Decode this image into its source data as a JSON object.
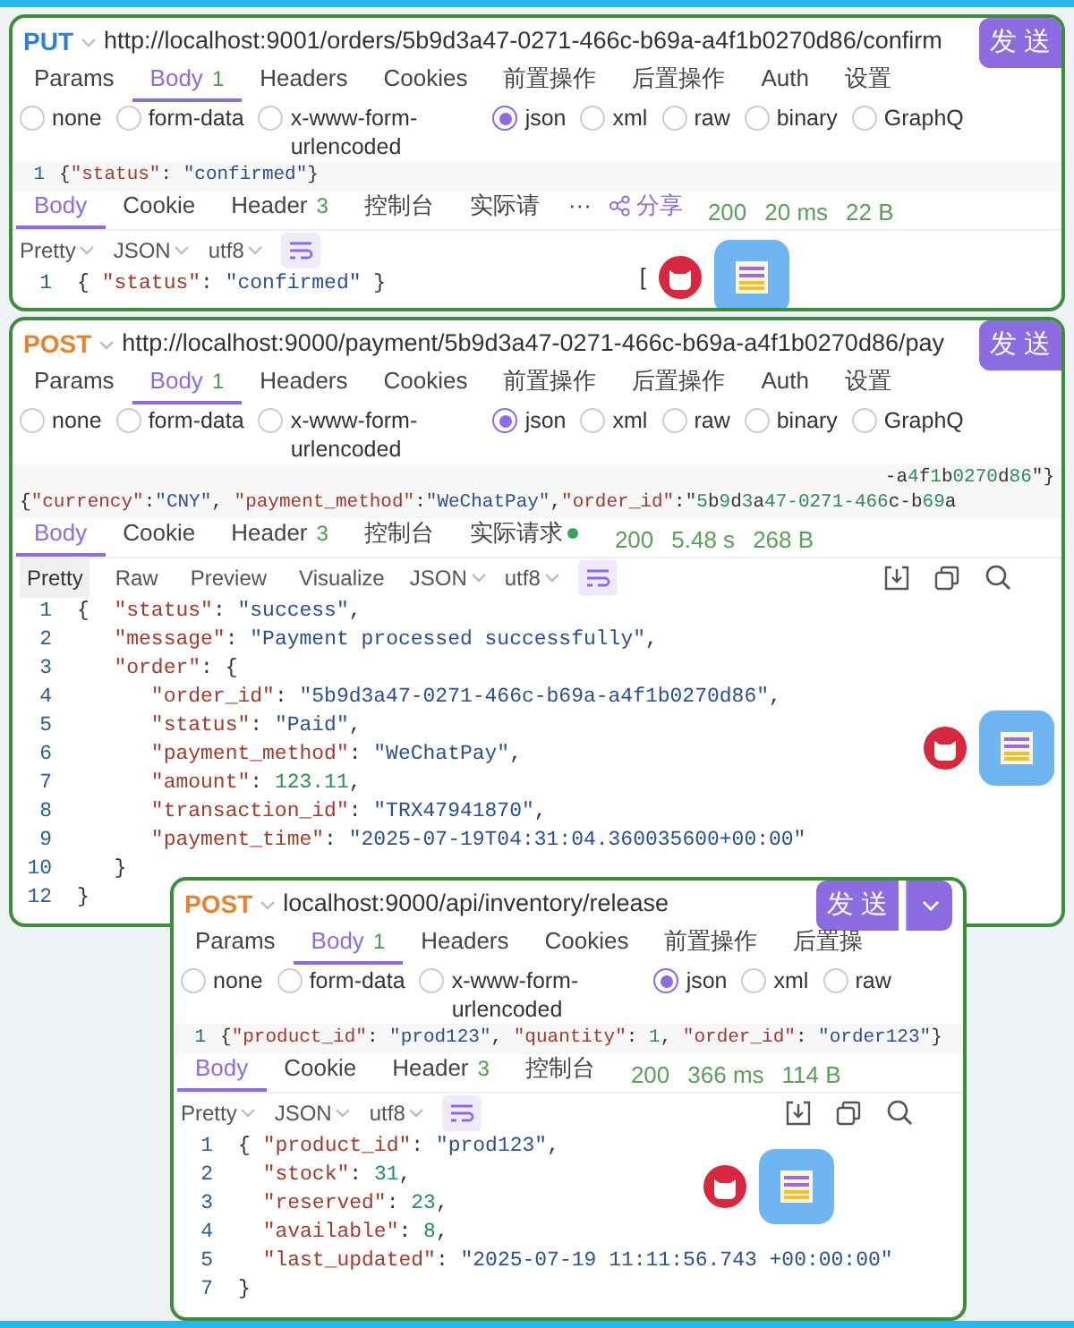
{
  "panels": [
    {
      "method": {
        "label": "PUT",
        "kind": "put"
      },
      "url": "http://localhost:9001/orders/5b9d3a47-0271-466c-b69a-a4f1b0270d86/confirm",
      "send": {
        "label": "发 送",
        "dropdown": false
      },
      "request_tabs": [
        {
          "label": "Params",
          "selected": false
        },
        {
          "label": "Body",
          "count": "1",
          "selected": true
        },
        {
          "label": "Headers",
          "selected": false
        },
        {
          "label": "Cookies",
          "selected": false
        },
        {
          "label": "前置操作",
          "selected": false
        },
        {
          "label": "后置操作",
          "selected": false
        },
        {
          "label": "Auth",
          "selected": false
        },
        {
          "label": "设置",
          "selected": false
        }
      ],
      "body_types": [
        {
          "label": "none",
          "selected": false
        },
        {
          "label": "form-data",
          "selected": false
        },
        {
          "label": "x-www-form-urlencoded",
          "selected": false
        },
        {
          "label": "json",
          "selected": true
        },
        {
          "label": "xml",
          "selected": false
        },
        {
          "label": "raw",
          "selected": false
        },
        {
          "label": "binary",
          "selected": false
        },
        {
          "label": "GraphQ",
          "selected": false
        }
      ],
      "request_body": {
        "lines": [
          {
            "number": "1",
            "text": "{\"status\": \"confirmed\"}"
          }
        ]
      },
      "response_tabs": [
        {
          "label": "Body",
          "selected": true
        },
        {
          "label": "Cookie",
          "selected": false
        },
        {
          "label": "Header",
          "count": "3",
          "selected": false
        },
        {
          "label": "控制台",
          "selected": false
        },
        {
          "label": "实际请",
          "selected": false,
          "dot": false
        }
      ],
      "response_actions": [
        {
          "kind": "more",
          "label": "···"
        },
        {
          "kind": "share",
          "label": "分享"
        }
      ],
      "status": {
        "code": "200",
        "time": "20 ms",
        "size": "22 B"
      },
      "selectors": [
        "Pretty",
        "JSON",
        "utf8"
      ],
      "toolbar_icons": [
        {
          "kind": "wrap"
        }
      ],
      "overlay_text": "[",
      "response_body": {
        "lines": [
          {
            "number": "1",
            "text": "{ \"status\": \"confirmed\" }"
          }
        ]
      }
    },
    {
      "method": {
        "label": "POST",
        "kind": "post"
      },
      "url": "http://localhost:9000/payment/5b9d3a47-0271-466c-b69a-a4f1b0270d86/pay",
      "send": {
        "label": "发 送",
        "dropdown": false
      },
      "request_tabs": [
        {
          "label": "Params",
          "selected": false
        },
        {
          "label": "Body",
          "count": "1",
          "selected": true
        },
        {
          "label": "Headers",
          "selected": false
        },
        {
          "label": "Cookies",
          "selected": false
        },
        {
          "label": "前置操作",
          "selected": false
        },
        {
          "label": "后置操作",
          "selected": false
        },
        {
          "label": "Auth",
          "selected": false
        },
        {
          "label": "设置",
          "selected": false
        }
      ],
      "body_types": [
        {
          "label": "none",
          "selected": false
        },
        {
          "label": "form-data",
          "selected": false
        },
        {
          "label": "x-www-form-urlencoded",
          "selected": false
        },
        {
          "label": "json",
          "selected": true
        },
        {
          "label": "xml",
          "selected": false
        },
        {
          "label": "raw",
          "selected": false
        },
        {
          "label": "binary",
          "selected": false
        },
        {
          "label": "GraphQ",
          "selected": false
        }
      ],
      "request_body": {
        "continuation": "-a4f1b0270d86\"}",
        "lines": [
          {
            "text": "{\"currency\":\"CNY\", \"payment_method\":\"WeChatPay\",\"order_id\":\"5b9d3a47-0271-466c-b69a"
          }
        ]
      },
      "response_tabs": [
        {
          "label": "Body",
          "selected": true
        },
        {
          "label": "Cookie",
          "selected": false
        },
        {
          "label": "Header",
          "count": "3",
          "selected": false
        },
        {
          "label": "控制台",
          "selected": false
        },
        {
          "label": "实际请求",
          "selected": false,
          "dot": true
        }
      ],
      "status": {
        "code": "200",
        "time": "5.48 s",
        "size": "268 B"
      },
      "view_modes": [
        {
          "label": "Pretty",
          "selected": true
        },
        {
          "label": "Raw",
          "selected": false
        },
        {
          "label": "Preview",
          "selected": false
        },
        {
          "label": "Visualize",
          "selected": false
        }
      ],
      "selectors": [
        "JSON",
        "utf8"
      ],
      "toolbar_icons": [
        {
          "kind": "wrap"
        },
        {
          "kind": "download"
        },
        {
          "kind": "copy"
        },
        {
          "kind": "search"
        }
      ],
      "response_body": {
        "lines": [
          {
            "number": "1",
            "text": "{  \"status\": \"success\","
          },
          {
            "number": "2",
            "text": "   \"message\": \"Payment processed successfully\","
          },
          {
            "number": "3",
            "text": "   \"order\": {"
          },
          {
            "number": "4",
            "text": "      \"order_id\": \"5b9d3a47-0271-466c-b69a-a4f1b0270d86\","
          },
          {
            "number": "5",
            "text": "      \"status\": \"Paid\","
          },
          {
            "number": "6",
            "text": "      \"payment_method\": \"WeChatPay\","
          },
          {
            "number": "7",
            "text": "      \"amount\": 123.11,"
          },
          {
            "number": "8",
            "text": "      \"transaction_id\": \"TRX47941870\","
          },
          {
            "number": "9",
            "text": "      \"payment_time\": \"2025-07-19T04:31:04.360035600+00:00\""
          },
          {
            "number": "10",
            "text": "   }"
          },
          {
            "number": "12",
            "text": "}"
          }
        ]
      }
    },
    {
      "method": {
        "label": "POST",
        "kind": "post"
      },
      "url": "localhost:9000/api/inventory/release",
      "send": {
        "label": "发 送",
        "dropdown": true
      },
      "request_tabs": [
        {
          "label": "Params",
          "selected": false
        },
        {
          "label": "Body",
          "count": "1",
          "selected": true
        },
        {
          "label": "Headers",
          "selected": false
        },
        {
          "label": "Cookies",
          "selected": false
        },
        {
          "label": "前置操作",
          "selected": false
        },
        {
          "label": "后置操",
          "selected": false
        }
      ],
      "body_types": [
        {
          "label": "none",
          "selected": false
        },
        {
          "label": "form-data",
          "selected": false
        },
        {
          "label": "x-www-form-urlencoded",
          "selected": false
        },
        {
          "label": "json",
          "selected": true
        },
        {
          "label": "xml",
          "selected": false
        },
        {
          "label": "raw",
          "selected": false
        }
      ],
      "request_body": {
        "lines": [
          {
            "number": "1",
            "text": "{\"product_id\": \"prod123\", \"quantity\": 1, \"order_id\": \"order123\"}"
          }
        ]
      },
      "response_tabs": [
        {
          "label": "Body",
          "selected": true
        },
        {
          "label": "Cookie",
          "selected": false
        },
        {
          "label": "Header",
          "count": "3",
          "selected": false
        },
        {
          "label": "控制台",
          "selected": false
        }
      ],
      "status": {
        "code": "200",
        "time": "366 ms",
        "size": "114 B"
      },
      "selectors": [
        "Pretty",
        "JSON",
        "utf8"
      ],
      "toolbar_icons": [
        {
          "kind": "wrap"
        },
        {
          "kind": "download"
        },
        {
          "kind": "copy"
        },
        {
          "kind": "search"
        }
      ],
      "response_body": {
        "lines": [
          {
            "number": "1",
            "text": "{ \"product_id\": \"prod123\","
          },
          {
            "number": "2",
            "text": "  \"stock\": 31,"
          },
          {
            "number": "3",
            "text": "  \"reserved\": 23,"
          },
          {
            "number": "4",
            "text": "  \"available\": 8,"
          },
          {
            "number": "5",
            "text": "  \"last_updated\": \"2025-07-19 11:11:56.743 +00:00:00\""
          },
          {
            "number": "7",
            "text": "}"
          }
        ]
      }
    }
  ]
}
